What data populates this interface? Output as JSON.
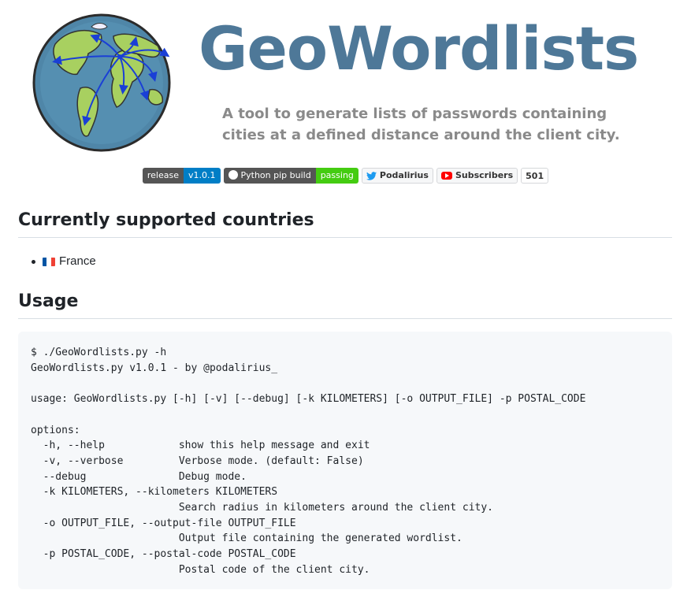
{
  "header": {
    "title": "GeoWordlists",
    "tagline": [
      "A tool to generate lists of passwords containing",
      "cities at a defined distance around the client city."
    ],
    "globe_icon": "globe-with-arrows-icon"
  },
  "badges": {
    "release": {
      "label": "release",
      "value": "v1.0.1"
    },
    "build": {
      "label": "Python pip build",
      "value": "passing",
      "icon": "github-icon"
    },
    "twitter": {
      "label": "Podalirius",
      "icon": "twitter-icon"
    },
    "youtube": {
      "label": "Subscribers",
      "count": "501",
      "icon": "youtube-icon"
    }
  },
  "sections": {
    "countries": {
      "heading": "Currently supported countries",
      "items": [
        {
          "flag": "france-flag-icon",
          "name": "France"
        }
      ]
    },
    "usage": {
      "heading": "Usage",
      "code": "$ ./GeoWordlists.py -h\nGeoWordlists.py v1.0.1 - by @podalirius_\n\nusage: GeoWordlists.py [-h] [-v] [--debug] [-k KILOMETERS] [-o OUTPUT_FILE] -p POSTAL_CODE\n\noptions:\n  -h, --help            show this help message and exit\n  -v, --verbose         Verbose mode. (default: False)\n  --debug               Debug mode.\n  -k KILOMETERS, --kilometers KILOMETERS\n                        Search radius in kilometers around the client city.\n  -o OUTPUT_FILE, --output-file OUTPUT_FILE\n                        Output file containing the generated wordlist.\n  -p POSTAL_CODE, --postal-code POSTAL_CODE\n                        Postal code of the client city."
    }
  },
  "colors": {
    "title": "#4e7898",
    "tagline": "#8a8a8a",
    "badge_blue": "#007ec6",
    "badge_green": "#44cc11",
    "code_bg": "#f6f8fa"
  }
}
